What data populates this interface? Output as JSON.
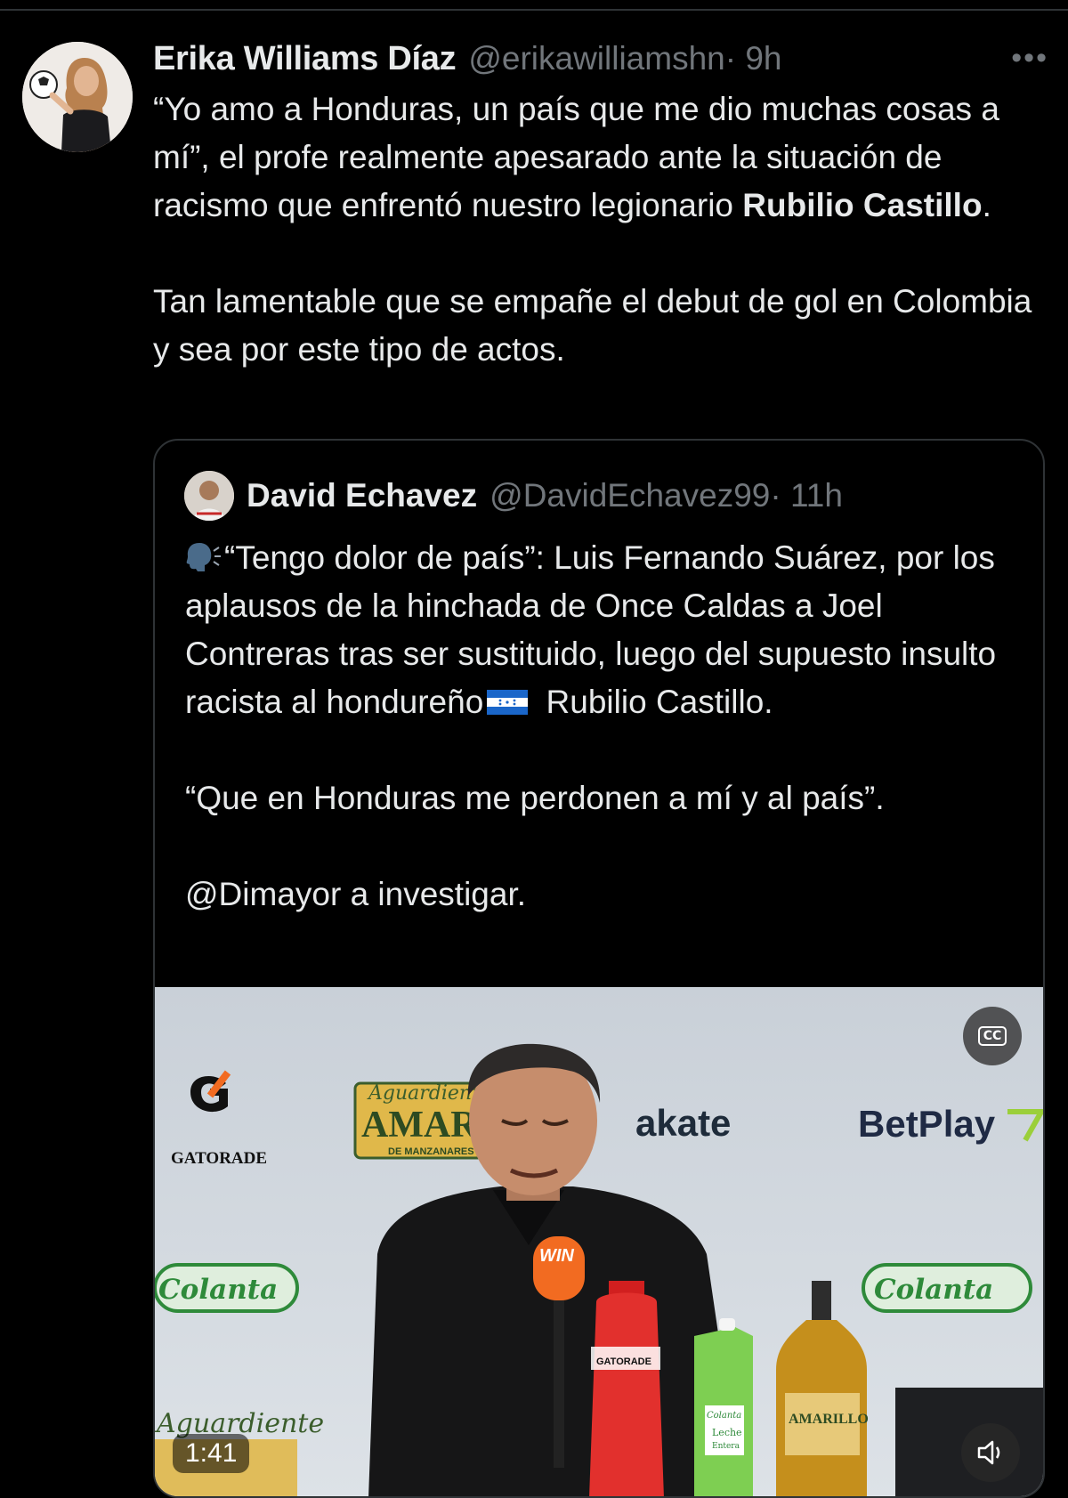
{
  "tweet": {
    "author_name": "Erika Williams Díaz",
    "handle": "@erikawilliamshn",
    "time": "· 9h",
    "more_label": "•••",
    "text_p1_a": "“Yo amo a Honduras, un país que me dio muchas cosas a mí”, el profe realmente apesarado ante la situación de racismo que enfrentó nuestro legionario ",
    "text_p1_bold": "Rubilio Castillo",
    "text_p1_end": ".",
    "text_p2": "Tan lamentable que se empañe el debut de gol en Colombia y sea por este tipo de actos."
  },
  "quoted": {
    "author_name": "David Echavez",
    "handle": "@DavidEchavez99",
    "time": "· 11h",
    "p1_a": "“Tengo dolor de país”: Luis Fernando Suárez, por los aplausos de la hinchada de Once Caldas a Joel Contreras tras ser sustituido, luego del supuesto insulto racista al hondureño",
    "p1_b": " Rubilio Castillo.",
    "p2": "“Que en Honduras me perdonen a mí y al país”.",
    "p3": "@Dimayor a investigar."
  },
  "media": {
    "duration": "1:41",
    "cc_label": "CC",
    "mute_icon": "speaker-icon",
    "sponsors": {
      "gatorade": "GATORADE",
      "aguardiente_script": "Aguardiente",
      "amarillo": "AMARILLO",
      "manzanares": "DE MANZANARES",
      "wakate": "akate",
      "betplay": "BetPlay",
      "colanta": "Colanta",
      "win": "WIN",
      "leche": "Leche",
      "entera": "Entera"
    }
  },
  "colors": {
    "background": "#000000",
    "text": "#e7e9ea",
    "muted": "#71767b",
    "border": "#2f3336"
  }
}
